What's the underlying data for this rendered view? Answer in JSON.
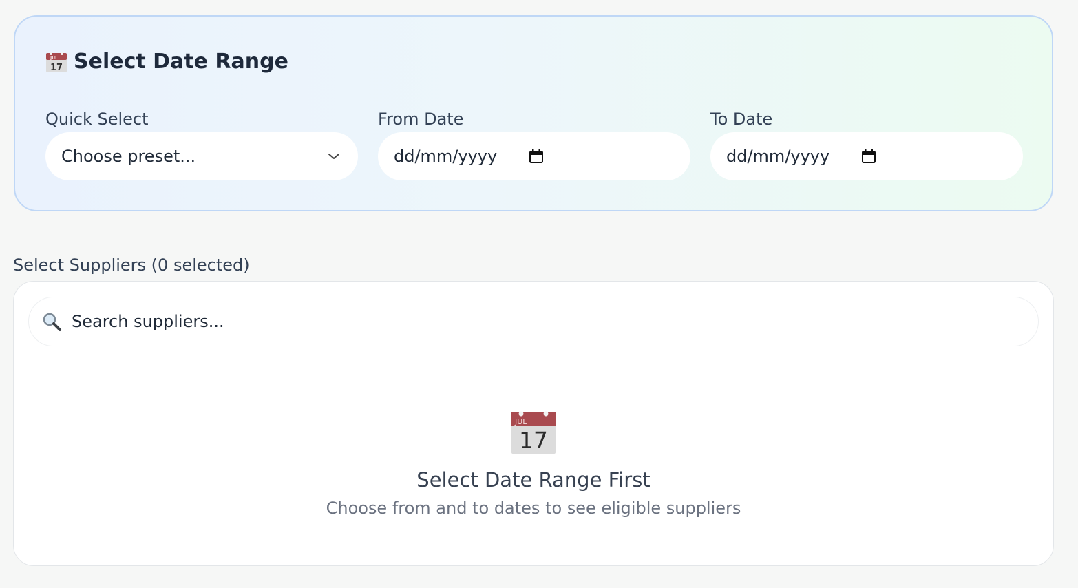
{
  "date_range": {
    "title": "Select Date Range",
    "title_icon": "calendar-icon",
    "quick_select": {
      "label": "Quick Select",
      "value": "Choose preset..."
    },
    "from_date": {
      "label": "From Date",
      "placeholder": "dd/mm/yyyy"
    },
    "to_date": {
      "label": "To Date",
      "placeholder": "dd/mm/yyyy"
    }
  },
  "suppliers": {
    "label": "Select Suppliers (0 selected)",
    "search": {
      "placeholder": "Search suppliers..."
    },
    "empty_state": {
      "icon": "calendar-icon",
      "calendar_month": "JUL",
      "calendar_day": "17",
      "title": "Select Date Range First",
      "subtitle": "Choose from and to dates to see eligible suppliers"
    }
  },
  "colors": {
    "card_border": "#bfd7f6",
    "calendar_red": "#a94a4f",
    "page_bg": "#f6f7f6"
  }
}
